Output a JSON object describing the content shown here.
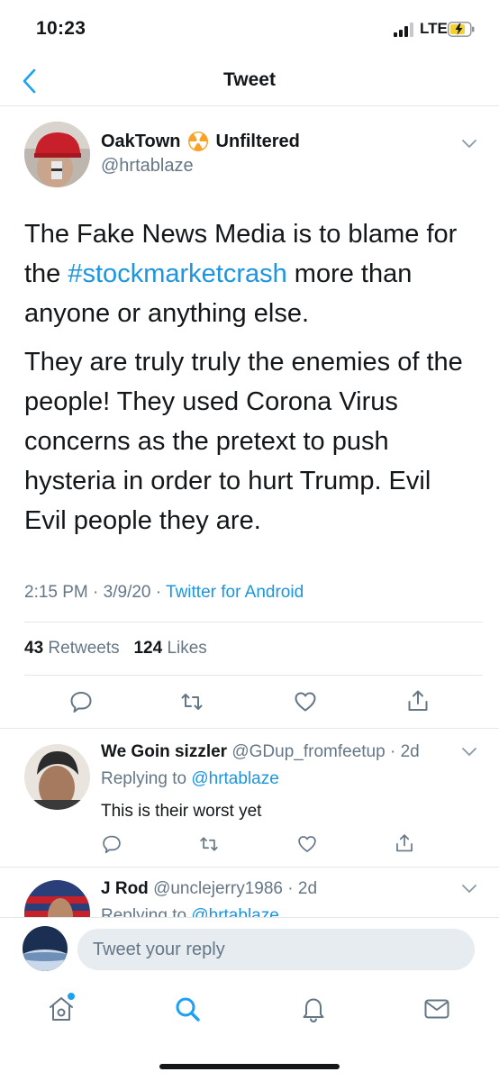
{
  "status_bar": {
    "time": "10:23",
    "network": "LTE"
  },
  "header": {
    "title": "Tweet"
  },
  "tweet": {
    "author_name": "OakTown",
    "author_suffix": "Unfiltered",
    "author_handle": "@hrtablaze",
    "body_line1_a": "The Fake News Media is to blame for",
    "body_line2_pre": "the ",
    "hashtag": "#stockmarketcrash",
    "body_line2_post": " more than",
    "body_line3": "anyone or anything else.",
    "body_para2": "They are truly truly the enemies of the people! They used Corona Virus concerns as the pretext to push hysteria in order to hurt Trump.  Evil Evil people they are.",
    "time": "2:15 PM",
    "date": "3/9/20",
    "source": "Twitter for Android",
    "retweets_count": "43",
    "retweets_label": "Retweets",
    "likes_count": "124",
    "likes_label": "Likes"
  },
  "replies": [
    {
      "name": "We Goin sizzler",
      "handle": "@GDup_fromfeetup",
      "age": "2d",
      "replying_prefix": "Replying to",
      "replying_to": "@hrtablaze",
      "text": "This is their worst yet"
    },
    {
      "name": "J Rod",
      "handle": "@unclejerry1986",
      "age": "2d",
      "replying_prefix": "Replying to",
      "replying_to": "@hrtablaze"
    }
  ],
  "composer": {
    "placeholder": "Tweet your reply"
  },
  "colors": {
    "accent": "#1b95e0",
    "secondary_text": "#657786",
    "divider": "#e1e8ed"
  }
}
